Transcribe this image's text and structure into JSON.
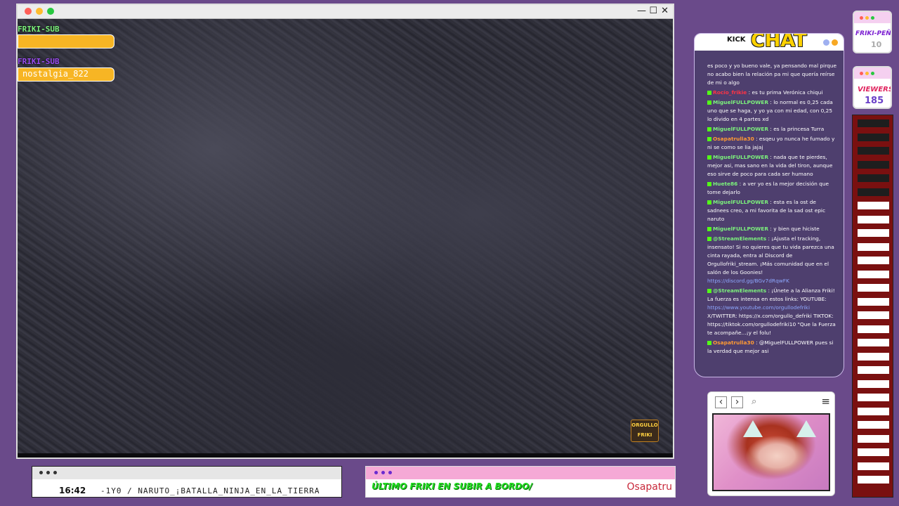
{
  "video": {
    "sub_label_1": "FRIKI-SUB",
    "sub_label_2": "FRIKI-SUB",
    "sub_name": "nostalgia_822",
    "window_controls": {
      "minimize": "—",
      "maximize": "☐",
      "close": "✕"
    },
    "watermark_text": "ORGULLO FRIKI"
  },
  "ticker": {
    "time": "16:42",
    "text": "-1Y0 / NARUTO_¡BATALLA_NINJA_EN_LA_TIERRA"
  },
  "last_friki": {
    "label": "ÚLTIMO FRIKI EN SUBIR A BORDO/",
    "name": "Osapatru"
  },
  "chat": {
    "kick": "KICK",
    "title": "CHAT",
    "messages": [
      {
        "user": "",
        "text": "es poco y yo bueno vale, ya pensando mal pirque no acabo bien la relación pa mi que quería reírse de mi o algo",
        "color": "#ffffff"
      },
      {
        "user": "Rocío_frikie",
        "text": ": es tu prima Verónica chiqui",
        "color": "#ff3344"
      },
      {
        "user": "MiguelFULLPOWER",
        "text": ": lo normal es 0,25 cada uno que se haga, y yo ya con mi edad, con 0,25 lo divido en 4 partes xd",
        "color": "#7cf27c"
      },
      {
        "user": "MiguelFULLPOWER",
        "text": ": es la princesa Turra",
        "color": "#7cf27c"
      },
      {
        "user": "Osapatrulla30",
        "text": ": esqeu yo nunca he fumado y ni se como se lia jajaj",
        "color": "#ff9a33"
      },
      {
        "user": "MiguelFULLPOWER",
        "text": ": nada que te pierdes, mejor asi, mas sano en la vida del tiron, aunque eso sirve de poco para cada ser humano",
        "color": "#7cf27c"
      },
      {
        "user": "Huete86",
        "text": ": a ver yo es la mejor decisión que tome dejarlo",
        "color": "#7cf27c"
      },
      {
        "user": "MiguelFULLPOWER",
        "text": ": esta es la ost de sadnees creo, a mi favorita de la sad ost epic naruto",
        "color": "#7cf27c"
      },
      {
        "user": "MiguelFULLPOWER",
        "text": ": y bien que hiciste",
        "color": "#7cf27c"
      },
      {
        "user": "@StreamElements",
        "text": ": ¡Ajusta el tracking, insensato! Si no quieres que tu vida parezca una cinta rayada, entra al Discord de Orgullofriki_stream. ¡Más comunidad que en el salón de los Goonies!",
        "link": "https://discord.gg/BGv7dRqwFK",
        "color": "#7cf27c"
      },
      {
        "user": "@StreamElements",
        "text": ": ¡Únete a la Alianza Friki! La fuerza es intensa en estos links: YOUTUBE:",
        "link": "https://www.youtube.com/orgullodefriki",
        "extra": "X/TWITTER: https://x.com/orgullo_defriki TIKTOK: https://tiktok.com/orgullodefriki10 \"Que la Fuerza te acompañe...¡y el folu!",
        "color": "#7cf27c"
      },
      {
        "user": "Osapatrulla30",
        "text": ": @MiguelFULLPOWER pues si la verdad que mejor asi",
        "color": "#ff9a33"
      }
    ]
  },
  "side": {
    "pena_label": "FRIKI-PEÑA",
    "pena_count": "10",
    "viewers_label": "VIEWERS",
    "viewers_count": "185"
  },
  "cam": {
    "back": "‹",
    "forward": "›",
    "search_icon": "⌕",
    "menu_icon": "≡"
  },
  "colors": {
    "background": "#6a4a8a",
    "accent_yellow": "#f7b524",
    "chat_bg": "#4e3f6e",
    "kick_green": "#53fc18"
  }
}
